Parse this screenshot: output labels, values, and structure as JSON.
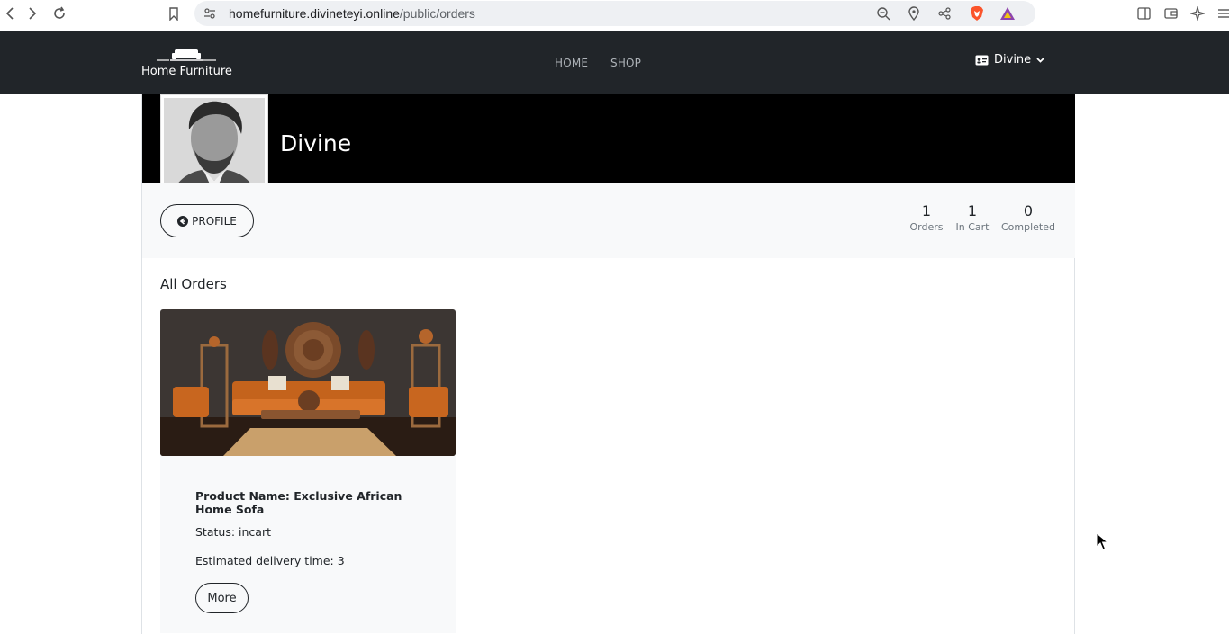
{
  "browser": {
    "url_host": "homefurniture.divineteyi.online",
    "url_path": "/public/orders"
  },
  "navbar": {
    "brand": "Home Furniture",
    "links": [
      {
        "label": "HOME"
      },
      {
        "label": "SHOP"
      }
    ],
    "user_name": "Divine"
  },
  "profile": {
    "name": "Divine",
    "profile_button_label": "PROFILE",
    "stats": [
      {
        "value": "1",
        "label": "Orders"
      },
      {
        "value": "1",
        "label": "In Cart"
      },
      {
        "value": "0",
        "label": "Completed"
      }
    ]
  },
  "orders": {
    "title": "All Orders",
    "items": [
      {
        "product_name": "Product Name: Exclusive African Home Sofa",
        "status": "Status: incart",
        "delivery": "Estimated delivery time: 3",
        "more_label": "More"
      }
    ]
  },
  "colors": {
    "navbar_bg": "#212529",
    "banner_bg": "#000000",
    "strip_bg": "#f8f9fa"
  }
}
